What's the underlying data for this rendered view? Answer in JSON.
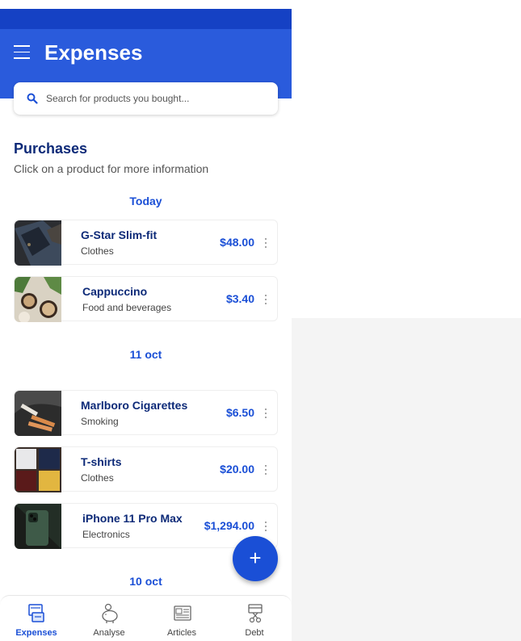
{
  "app": {
    "title": "Expenses"
  },
  "search": {
    "placeholder": "Search for products you bought..."
  },
  "purchases": {
    "title": "Purchases",
    "subtitle": "Click on a product for more information"
  },
  "groups": [
    {
      "date": "Today",
      "items": [
        {
          "name": "G-Star Slim-fit",
          "category": "Clothes",
          "price": "$48.00"
        },
        {
          "name": "Cappuccino",
          "category": "Food and beverages",
          "price": "$3.40"
        }
      ]
    },
    {
      "date": "11 oct",
      "items": [
        {
          "name": "Marlboro Cigarettes",
          "category": "Smoking",
          "price": "$6.50"
        },
        {
          "name": "T-shirts",
          "category": "Clothes",
          "price": "$20.00"
        },
        {
          "name": "iPhone 11 Pro Max",
          "category": "Electronics",
          "price": "$1,294.00"
        }
      ]
    },
    {
      "date": "10 oct",
      "items": []
    }
  ],
  "fab": {
    "label": "+"
  },
  "nav": [
    {
      "label": "Expenses",
      "icon": "wallet-icon",
      "active": true
    },
    {
      "label": "Analyse",
      "icon": "piggy-bank-icon",
      "active": false
    },
    {
      "label": "Articles",
      "icon": "newspaper-icon",
      "active": false
    },
    {
      "label": "Debt",
      "icon": "scissors-card-icon",
      "active": false
    }
  ],
  "colors": {
    "appbar": "#2a5bdc",
    "statusbar": "#1541c4",
    "accent": "#1a4fd6",
    "title_text": "#0d2a78"
  }
}
